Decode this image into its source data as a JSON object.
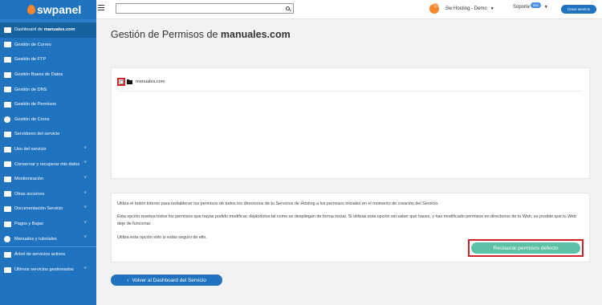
{
  "brand": {
    "name": "swpanel",
    "colors": {
      "sidebar": "#1f73bf",
      "accent_orange": "#f5862a",
      "restore_green": "#5cc1a6",
      "highlight_red": "#d12229"
    }
  },
  "sidebar": {
    "items": [
      {
        "icon": "dashboard-icon",
        "label_prefix": "Dashboard de ",
        "label_bold": "manuales.com",
        "has_chevron": false
      },
      {
        "icon": "mail-icon",
        "label": "Gestión de Correo",
        "has_chevron": false
      },
      {
        "icon": "database-icon",
        "label": "Gestión de FTP",
        "has_chevron": false
      },
      {
        "icon": "database-icon",
        "label": "Gestión Bases de Datos",
        "has_chevron": false
      },
      {
        "icon": "flag-icon",
        "label": "Gestión de DNS",
        "has_chevron": false
      },
      {
        "icon": "permissions-icon",
        "label": "Gestión de Permisos",
        "has_chevron": false
      },
      {
        "icon": "crons-icon",
        "label": "Gestión de Crons",
        "has_chevron": false
      },
      {
        "icon": "server-icon",
        "label": "Servidores del servicio",
        "has_chevron": false
      },
      {
        "icon": "usage-icon",
        "label": "Uso del servicio",
        "has_chevron": true
      },
      {
        "icon": "backup-icon",
        "label": "Conservar y recuperar mis datos",
        "has_chevron": true
      },
      {
        "icon": "monitor-icon",
        "label": "Monitorización",
        "has_chevron": true
      },
      {
        "icon": "actions-icon",
        "label": "Otras acciones",
        "has_chevron": true
      },
      {
        "icon": "document-icon",
        "label": "Documentación Servicio",
        "has_chevron": true
      },
      {
        "icon": "payments-icon",
        "label": "Pagos y Bajas",
        "has_chevron": true
      },
      {
        "icon": "help-icon",
        "label": "Manuales y tutoriales",
        "has_chevron": true
      }
    ],
    "bottom_items": [
      {
        "icon": "tree-icon",
        "label": "Árbol de servicios activos",
        "has_chevron": false
      },
      {
        "icon": "recent-icon",
        "label": "Últimos servicios gestionados",
        "has_chevron": true
      }
    ]
  },
  "topbar": {
    "search_placeholder": "",
    "account_name": "Sw Hosting - Demo",
    "support_label": "Soporte",
    "support_badge": "999",
    "create_service_label": "Crear servicio"
  },
  "page": {
    "title_prefix": "Gestión de Permisos de ",
    "title_bold": "manuales.com",
    "tree_root_label": "manuales.com",
    "info_1": "Utiliza el botón inferior para restablecer los permisos de todos los directorios de tu Servicios de Hosting a los permisos iniciales en el momento de creación del Servicio.",
    "info_2": "Esta opción resetea todos los permisos que hayas podido modificar, dejándolos tal como se despliegan de forma inicial. Si utilizas esta opción sin saber qué haces, y has modificado permisos en directorios de tu Web, es posible que tu Web deje de funcionar.",
    "info_3": "Utiliza esta opción sólo si estás seguro de ello.",
    "restore_button": "Restaurar permisos defecto",
    "back_button": "Volver al Dashboard del Servicio",
    "back_arrow": "‹"
  }
}
